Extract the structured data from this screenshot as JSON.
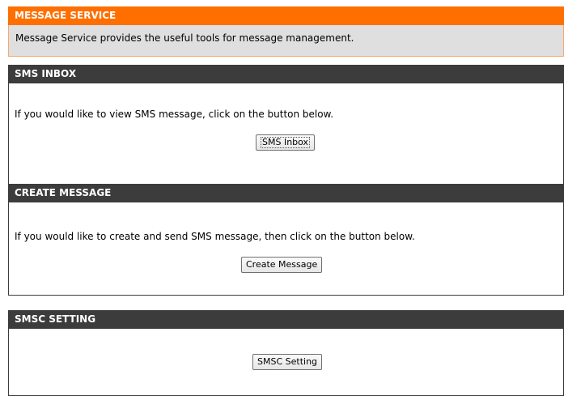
{
  "message_service": {
    "title": "MESSAGE SERVICE",
    "description": "Message Service provides the useful tools for message management."
  },
  "sms_inbox": {
    "title": "SMS INBOX",
    "text": "If you would like to view SMS message, click on the button below.",
    "button_label": "SMS Inbox"
  },
  "create_message": {
    "title": "CREATE MESSAGE",
    "text": "If you would like to create and send SMS message, then click on the button below.",
    "button_label": "Create Message"
  },
  "smsc_setting": {
    "title": "SMSC SETTING",
    "button_label": "SMSC Setting"
  },
  "colors": {
    "orange_header": "#ff6f00",
    "dark_header": "#3c3c3c",
    "description_bg": "#dfdfdf"
  }
}
